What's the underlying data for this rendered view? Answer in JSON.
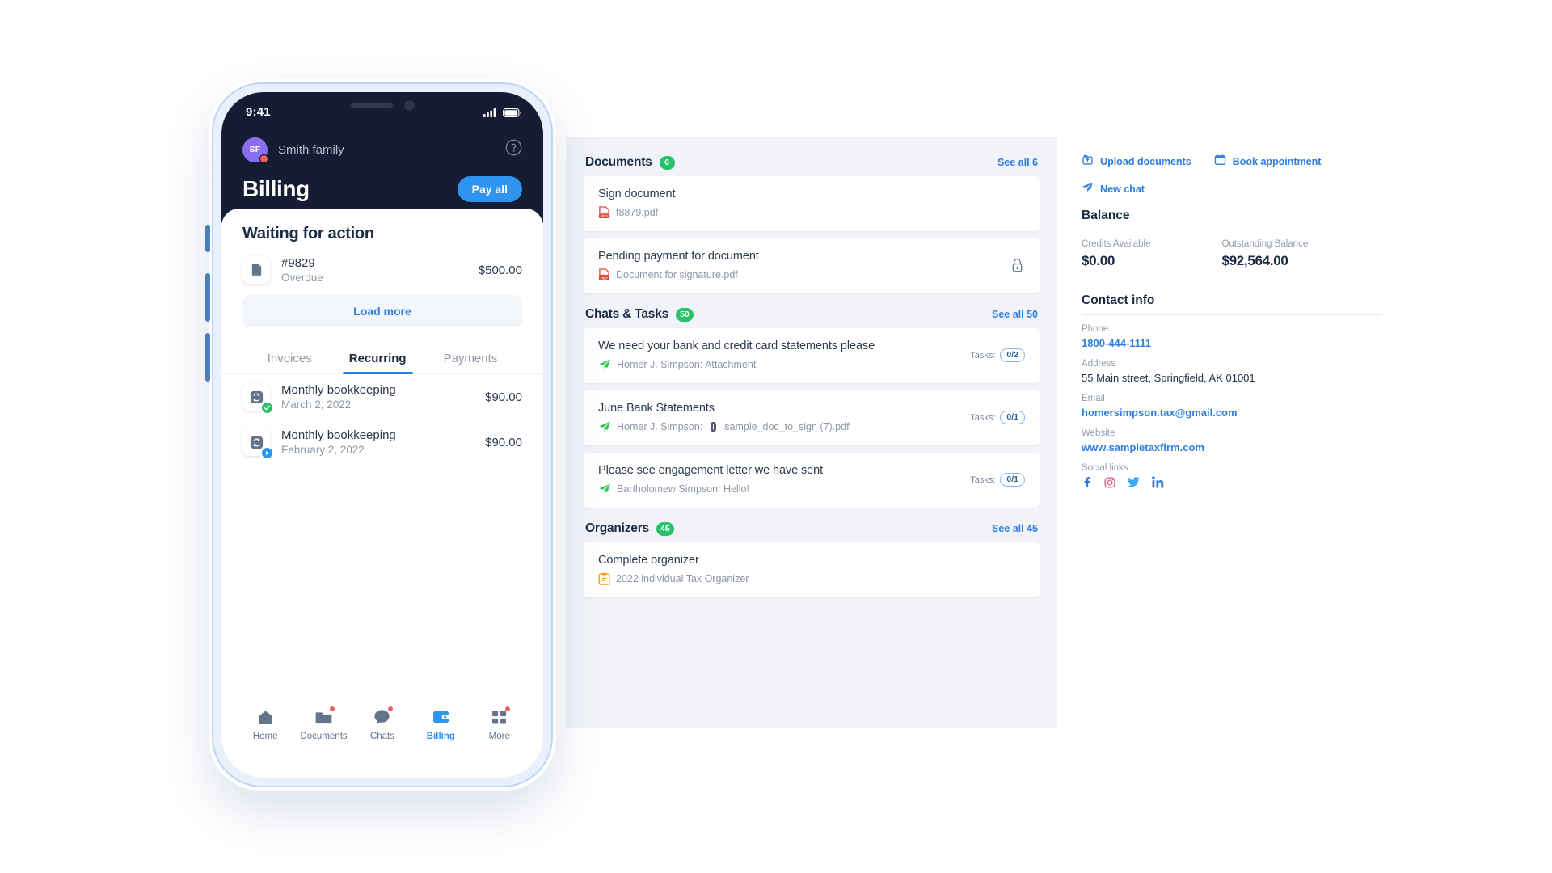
{
  "phone": {
    "status_bar": {
      "time": "9:41",
      "signal_icon": "cellular-signal-icon",
      "battery_icon": "battery-icon"
    },
    "header": {
      "avatar_initials": "SF",
      "account_name": "Smith family",
      "help_icon": "help-circle-icon",
      "page_title": "Billing",
      "pay_all_label": "Pay all"
    },
    "waiting": {
      "title": "Waiting for action",
      "invoice": {
        "icon": "invoice-document-icon",
        "number": "#9829",
        "status": "Overdue",
        "amount": "$500.00"
      },
      "load_more_label": "Load more"
    },
    "tabs": [
      {
        "label": "Invoices",
        "active": false
      },
      {
        "label": "Recurring",
        "active": true
      },
      {
        "label": "Payments",
        "active": false
      }
    ],
    "recurring": [
      {
        "icon": "recurring-sync-icon",
        "status_icon": "check-circle-icon",
        "status_color": "#27c26a",
        "name": "Monthly bookkeeping",
        "date": "March 2, 2022",
        "amount": "$90.00"
      },
      {
        "icon": "recurring-sync-icon",
        "status_icon": "play-circle-icon",
        "status_color": "#2f93f0",
        "name": "Monthly bookkeeping",
        "date": "February 2, 2022",
        "amount": "$90.00"
      }
    ],
    "tabbar": [
      {
        "label": "Home",
        "icon": "home-icon",
        "active": false,
        "dot": false
      },
      {
        "label": "Documents",
        "icon": "folder-icon",
        "active": false,
        "dot": true
      },
      {
        "label": "Chats",
        "icon": "chat-bubble-icon",
        "active": false,
        "dot": true
      },
      {
        "label": "Billing",
        "icon": "wallet-icon",
        "active": true,
        "dot": false
      },
      {
        "label": "More",
        "icon": "grid-plus-icon",
        "active": false,
        "dot": true
      }
    ]
  },
  "web": {
    "sections": [
      {
        "title": "Documents",
        "count": "6",
        "see_all": "See all 6",
        "items": [
          {
            "title": "Sign document",
            "icon": "pdf-icon",
            "sub": "f8879.pdf",
            "trailing_icon": null,
            "tasks": null
          },
          {
            "title": "Pending payment for document",
            "icon": "pdf-icon",
            "sub": "Document for signature.pdf",
            "trailing_icon": "lock-icon",
            "tasks": null
          }
        ]
      },
      {
        "title": "Chats & Tasks",
        "count": "50",
        "see_all": "See all 50",
        "items": [
          {
            "title": "We need your bank and credit card statements please",
            "icon": "paper-plane-icon",
            "sub": "Homer J. Simpson: Attachment",
            "attachment_icon": null,
            "tasks_label": "Tasks:",
            "tasks": "0/2"
          },
          {
            "title": "June Bank Statements",
            "icon": "paper-plane-icon",
            "sub": "Homer J. Simpson:",
            "attachment_icon": "paperclip-icon",
            "sub2": "sample_doc_to_sign (7).pdf",
            "tasks_label": "Tasks:",
            "tasks": "0/1"
          },
          {
            "title": "Please see engagement letter we have sent",
            "icon": "paper-plane-icon",
            "sub": "Bartholomew Simpson: Hello!",
            "attachment_icon": null,
            "tasks_label": "Tasks:",
            "tasks": "0/1"
          }
        ]
      },
      {
        "title": "Organizers",
        "count": "45",
        "see_all": "See all 45",
        "items": [
          {
            "title": "Complete organizer",
            "icon": "organizer-clipboard-icon",
            "sub": "2022 individual Tax Organizer",
            "tasks": null
          }
        ]
      }
    ]
  },
  "info": {
    "quick_actions": [
      {
        "label": "Upload documents",
        "icon": "upload-icon"
      },
      {
        "label": "Book appointment",
        "icon": "calendar-icon"
      },
      {
        "label": "New chat",
        "icon": "paper-plane-icon"
      }
    ],
    "balance": {
      "title": "Balance",
      "credits_label": "Credits Available",
      "credits_value": "$0.00",
      "outstanding_label": "Outstanding Balance",
      "outstanding_value": "$92,564.00"
    },
    "contact": {
      "title": "Contact info",
      "phone_label": "Phone",
      "phone_value": "1800-444-1111",
      "address_label": "Address",
      "address_value": "55 Main street, Springfield, AK 01001",
      "email_label": "Email",
      "email_value": "homersimpson.tax@gmail.com",
      "website_label": "Website",
      "website_value": "www.sampletaxfirm.com",
      "social_label": "Social links",
      "social": [
        {
          "icon": "facebook-icon",
          "color": "#2f7fe0"
        },
        {
          "icon": "instagram-icon",
          "color": "#e4558a"
        },
        {
          "icon": "twitter-icon",
          "color": "#3fa9f5"
        },
        {
          "icon": "linkedin-icon",
          "color": "#2f7fe0"
        }
      ]
    }
  },
  "colors": {
    "accent": "#2f7fe0",
    "accent_bright": "#2f93f0",
    "dark": "#141d33",
    "green": "#27c26a",
    "red": "#f1615c"
  }
}
